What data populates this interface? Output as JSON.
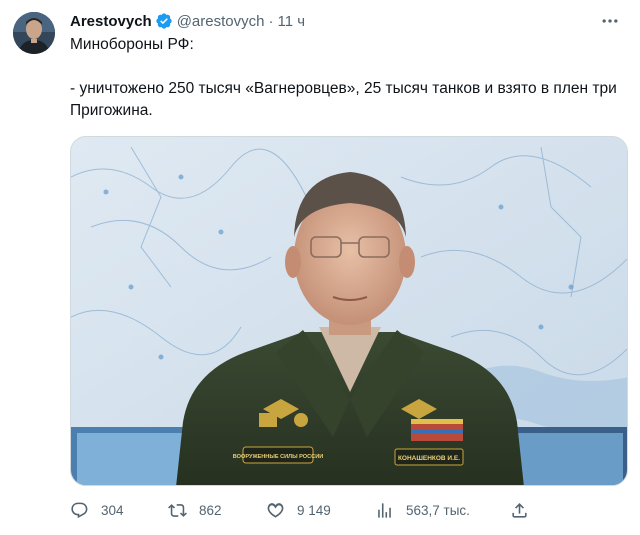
{
  "tweet": {
    "author_name": "Arestovych",
    "handle": "@arestovych",
    "separator": "·",
    "time": "11 ч",
    "text_line1": "Минобороны РФ:",
    "text_line2": "- уничтожено 250 тысяч «Вагнеровцев», 25 тысяч танков и взято в плен три Пригожина.",
    "media": {
      "chevron_label": "ВООРУЖЕННЫЕ СИЛЫ РОССИИ",
      "name_tag": "КОНАШЕНКОВ И.Е."
    }
  },
  "actions": {
    "reply_count": "304",
    "retweet_count": "862",
    "like_count": "9 149",
    "views_count": "563,7 тыс."
  },
  "icons": {
    "verified": "verified-badge-icon",
    "more": "more-icon",
    "reply": "reply-icon",
    "retweet": "retweet-icon",
    "like": "heart-icon",
    "views": "views-chart-icon",
    "share": "share-icon"
  },
  "colors": {
    "accent": "#1d9bf0",
    "text": "#0f1419",
    "secondary": "#536471",
    "border": "#cfd9de"
  }
}
